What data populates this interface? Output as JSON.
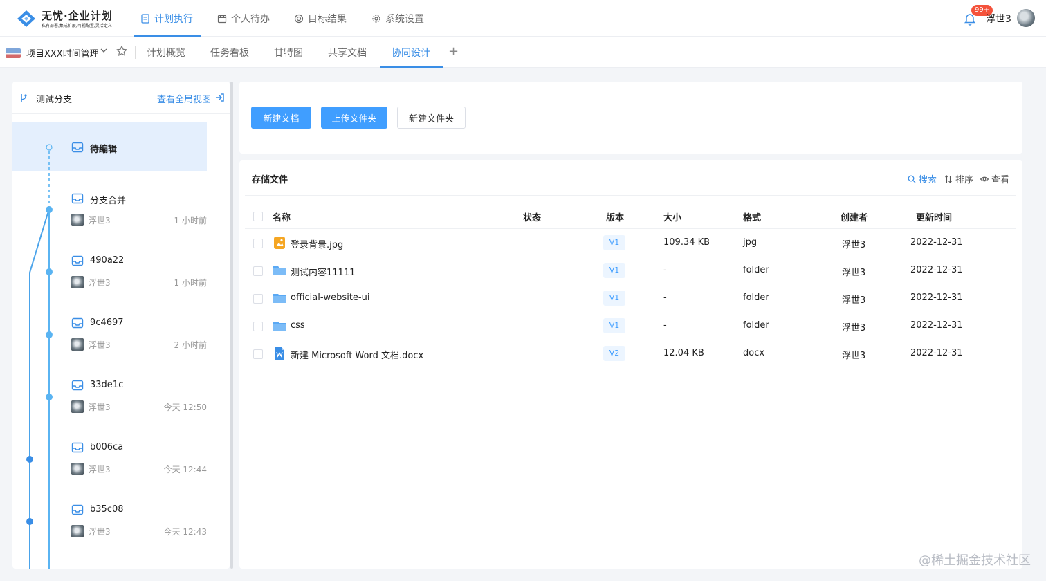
{
  "app": {
    "logo_title": "无忧·企业计划",
    "logo_subtitle": "私有部署,集成扩展,可视配置,灵活定义",
    "brand_color": "#3a8ee6"
  },
  "top_nav": [
    {
      "label": "计划执行",
      "icon": "document-icon",
      "active": true
    },
    {
      "label": "个人待办",
      "icon": "calendar-icon",
      "active": false
    },
    {
      "label": "目标结果",
      "icon": "target-icon",
      "active": false
    },
    {
      "label": "系统设置",
      "icon": "gear-icon",
      "active": false
    }
  ],
  "user": {
    "name": "浮世3",
    "notifications": "99+"
  },
  "project": {
    "name": "项目XXX时间管理"
  },
  "sub_nav": [
    {
      "label": "计划概览",
      "active": false
    },
    {
      "label": "任务看板",
      "active": false
    },
    {
      "label": "甘特图",
      "active": false
    },
    {
      "label": "共享文档",
      "active": false
    },
    {
      "label": "协同设计",
      "active": true
    }
  ],
  "sub_nav_add": "+",
  "branch_panel": {
    "title": "测试分支",
    "global_view_label": "查看全局视图",
    "nodes": [
      {
        "title": "待编辑",
        "user": "",
        "time": "",
        "active": true
      },
      {
        "title": "分支合并",
        "user": "浮世3",
        "time": "1 小时前"
      },
      {
        "title": "490a22",
        "user": "浮世3",
        "time": "1 小时前"
      },
      {
        "title": "9c4697",
        "user": "浮世3",
        "time": "2 小时前"
      },
      {
        "title": "33de1c",
        "user": "浮世3",
        "time": "今天 12:50"
      },
      {
        "title": "b006ca",
        "user": "浮世3",
        "time": "今天 12:44"
      },
      {
        "title": "b35c08",
        "user": "浮世3",
        "time": "今天 12:43"
      }
    ]
  },
  "actions": {
    "new_doc": "新建文档",
    "upload_folder": "上传文件夹",
    "new_folder": "新建文件夹"
  },
  "files": {
    "title": "存储文件",
    "tools": {
      "search": "搜索",
      "sort": "排序",
      "view": "查看"
    },
    "columns": {
      "name": "名称",
      "status": "状态",
      "version": "版本",
      "size": "大小",
      "format": "格式",
      "creator": "创建者",
      "updated": "更新时间"
    },
    "rows": [
      {
        "icon": "image-file-icon",
        "name": "登录背景.jpg",
        "status": "",
        "version": "V1",
        "size": "109.34 KB",
        "format": "jpg",
        "creator": "浮世3",
        "updated": "2022-12-31"
      },
      {
        "icon": "folder-icon",
        "name": "测试内容11111",
        "status": "",
        "version": "V1",
        "size": "-",
        "format": "folder",
        "creator": "浮世3",
        "updated": "2022-12-31"
      },
      {
        "icon": "folder-icon",
        "name": "official-website-ui",
        "status": "",
        "version": "V1",
        "size": "-",
        "format": "folder",
        "creator": "浮世3",
        "updated": "2022-12-31"
      },
      {
        "icon": "folder-icon",
        "name": "css",
        "status": "",
        "version": "V1",
        "size": "-",
        "format": "folder",
        "creator": "浮世3",
        "updated": "2022-12-31"
      },
      {
        "icon": "word-file-icon",
        "name": "新建 Microsoft Word 文档.docx",
        "status": "",
        "version": "V2",
        "size": "12.04 KB",
        "format": "docx",
        "creator": "浮世3",
        "updated": "2022-12-31"
      }
    ]
  },
  "watermark": "@稀土掘金技术社区"
}
